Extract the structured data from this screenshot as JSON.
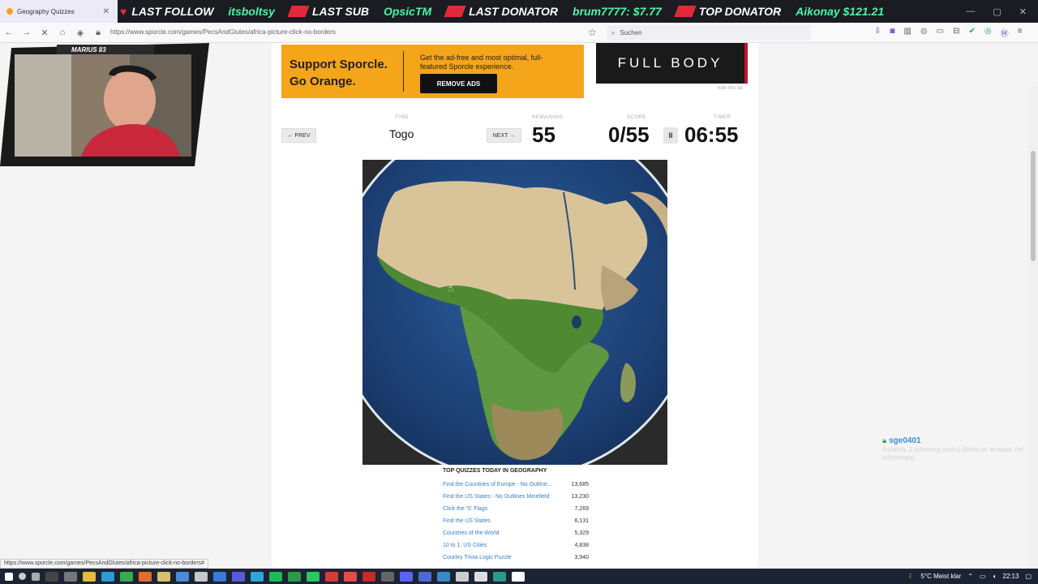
{
  "browser": {
    "tab_title": "Geography Quizzes",
    "url": "https://www.sporcle.com/games/PecsAndGlutes/africa-picture-click-no-borders",
    "search_placeholder": "Suchen",
    "status_url": "https://www.sporcle.com/games/PecsAndGlutes/africa-picture-click-no-borders#"
  },
  "stream_bar": {
    "items": [
      {
        "label": "LAST FOLLOW",
        "value": "itsboltsy"
      },
      {
        "label": "LAST SUB",
        "value": "OpsicTM"
      },
      {
        "label": "LAST DONATOR",
        "value": "brum7777: $7.77"
      },
      {
        "label": "TOP DONATOR",
        "value": "Aikonay $121.21"
      }
    ]
  },
  "webcam": {
    "nameplate": "MARIUS 83"
  },
  "ad": {
    "headline": "Support Sporcle. Go Orange.",
    "text": "Get the ad-free and most optimal, full-featured Sporcle experience.",
    "button": "REMOVE ADS",
    "promo": "FULL BODY WORKOUT",
    "hide": "hide this ad"
  },
  "quiz": {
    "prev": "← PREV",
    "find_label": "FIND",
    "find_value": "Togo",
    "next": "NEXT →",
    "remaining_label": "REMAINING",
    "remaining": "55",
    "score_label": "SCORE",
    "score": "0/55",
    "timer_label": "TIMER",
    "timer": "06:55",
    "pause": "II"
  },
  "top_quizzes": {
    "title": "TOP QUIZZES TODAY IN GEOGRAPHY",
    "rows": [
      {
        "name": "Find the Countries of Europe - No Outline...",
        "count": "13,685"
      },
      {
        "name": "Find the US States - No Outlines Minefield",
        "count": "13,230"
      },
      {
        "name": "Click the 'S' Flags",
        "count": "7,269"
      },
      {
        "name": "Find the US States",
        "count": "6,131"
      },
      {
        "name": "Countries of the World",
        "count": "5,329"
      },
      {
        "name": "10 to 1: US Cities",
        "count": "4,838"
      },
      {
        "name": "Country Trivia Logic Puzzle",
        "count": "3,940"
      }
    ]
  },
  "chat": {
    "user": "sge0401",
    "message": "Asiatus 2 (coming soon) (links in answer for infomean)"
  },
  "taskbar": {
    "weather": "5°C  Meist klar",
    "time": "22:13"
  },
  "colors": {
    "accent_orange": "#f4a51a",
    "link_blue": "#3a7fc4",
    "stream_green": "#4df5a6",
    "stream_red": "#e02a3a"
  }
}
